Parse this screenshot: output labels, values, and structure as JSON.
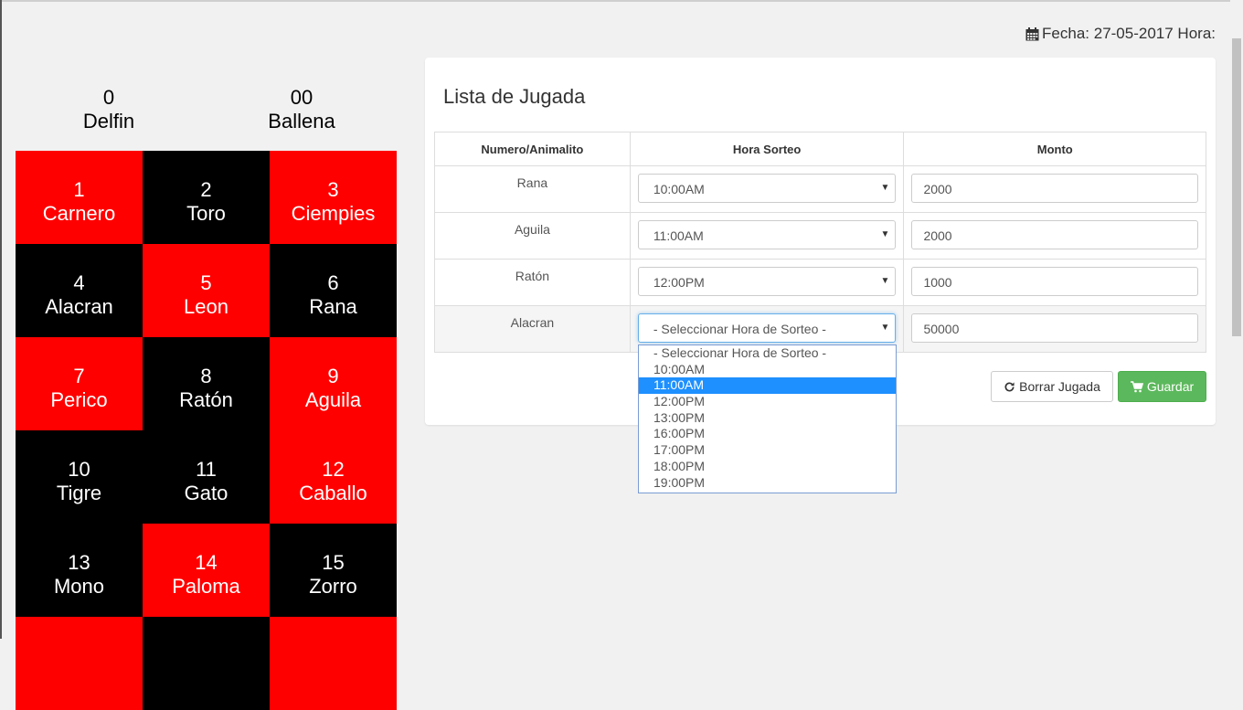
{
  "header": {
    "fecha_text": "Fecha: 27-05-2017 Hora:",
    "icon": "calendar-icon"
  },
  "specials": [
    {
      "number": "0",
      "name": "Delfin"
    },
    {
      "number": "00",
      "name": "Ballena"
    }
  ],
  "animals": [
    {
      "number": "1",
      "name": "Carnero",
      "color": "red"
    },
    {
      "number": "2",
      "name": "Toro",
      "color": "black"
    },
    {
      "number": "3",
      "name": "Ciempies",
      "color": "red"
    },
    {
      "number": "4",
      "name": "Alacran",
      "color": "black"
    },
    {
      "number": "5",
      "name": "Leon",
      "color": "red"
    },
    {
      "number": "6",
      "name": "Rana",
      "color": "black"
    },
    {
      "number": "7",
      "name": "Perico",
      "color": "red"
    },
    {
      "number": "8",
      "name": "Ratón",
      "color": "black"
    },
    {
      "number": "9",
      "name": "Aguila",
      "color": "red"
    },
    {
      "number": "10",
      "name": "Tigre",
      "color": "black"
    },
    {
      "number": "11",
      "name": "Gato",
      "color": "black"
    },
    {
      "number": "12",
      "name": "Caballo",
      "color": "red"
    },
    {
      "number": "13",
      "name": "Mono",
      "color": "black"
    },
    {
      "number": "14",
      "name": "Paloma",
      "color": "red"
    },
    {
      "number": "15",
      "name": "Zorro",
      "color": "black"
    }
  ],
  "colors": {
    "red": "#ff0000",
    "black": "#000000",
    "success": "#5cb85c",
    "highlight": "#1e90ff"
  },
  "panel": {
    "title": "Lista de Jugada",
    "columns": [
      "Numero/Animalito",
      "Hora Sorteo",
      "Monto"
    ],
    "rows": [
      {
        "animal": "Rana",
        "hora": "10:00AM",
        "monto": "2000"
      },
      {
        "animal": "Aguila",
        "hora": "11:00AM",
        "monto": "2000"
      },
      {
        "animal": "Ratón",
        "hora": "12:00PM",
        "monto": "1000"
      },
      {
        "animal": "Alacran",
        "hora": "- Seleccionar Hora de Sorteo -",
        "monto": "50000"
      }
    ],
    "borrar_label": "Borrar Jugada",
    "guardar_label": "Guardar"
  },
  "dropdown": {
    "options": [
      "- Seleccionar Hora de Sorteo -",
      "10:00AM",
      "11:00AM",
      "12:00PM",
      "13:00PM",
      "16:00PM",
      "17:00PM",
      "18:00PM",
      "19:00PM"
    ],
    "highlighted": "11:00AM"
  }
}
